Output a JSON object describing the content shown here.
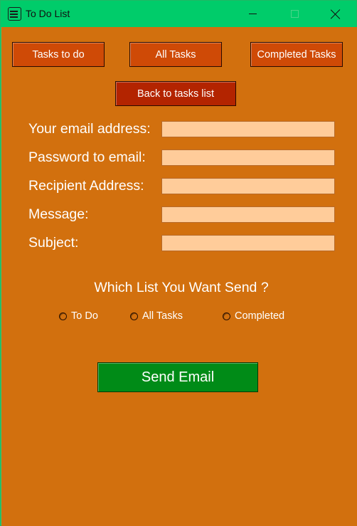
{
  "window": {
    "title": "To Do List"
  },
  "nav": {
    "tasks_to_do": "Tasks to do",
    "all_tasks": "All Tasks",
    "completed_tasks": "Completed Tasks",
    "back": "Back to tasks list"
  },
  "form": {
    "email_label": "Your email address:",
    "email_value": "",
    "password_label": "Password to email:",
    "password_value": "",
    "recipient_label": "Recipient Address:",
    "recipient_value": "",
    "message_label": "Message:",
    "message_value": "",
    "subject_label": "Subject:",
    "subject_value": ""
  },
  "list_choice": {
    "question": "Which List You Want Send ?",
    "options": [
      "To Do",
      "All Tasks",
      "Completed"
    ],
    "selected": null
  },
  "send_button": "Send Email",
  "colors": {
    "titlebar": "#00cc6a",
    "background": "#d2700e",
    "nav_button": "#cf4a06",
    "back_button": "#b32400",
    "input_fill": "#ffcc9a",
    "send_button": "#008b17"
  }
}
